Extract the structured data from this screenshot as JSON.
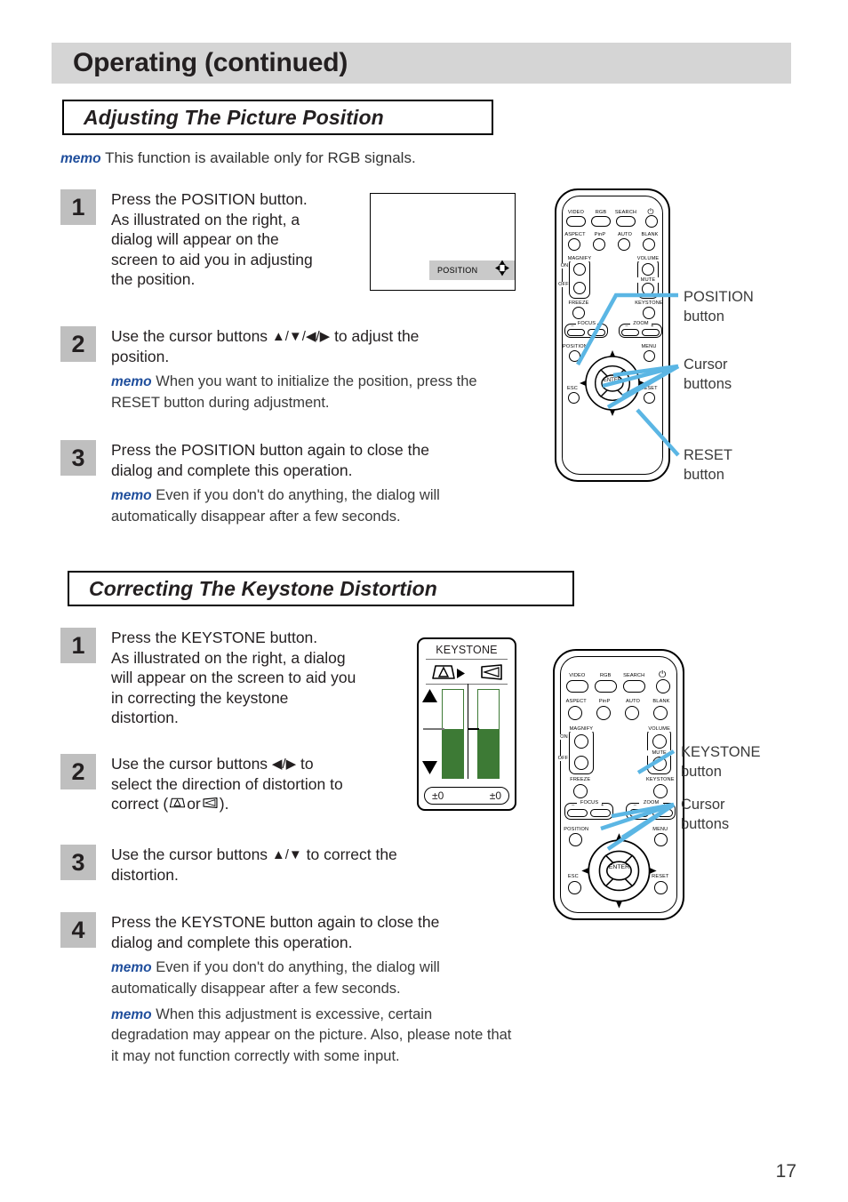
{
  "page": {
    "banner_title": "Operating (continued)",
    "page_number": "17"
  },
  "section1": {
    "title": "Adjusting The Picture Position",
    "intro_memo_word": "memo",
    "intro_memo_text": " This function is available only for RGB signals.",
    "steps": [
      {
        "number": "1",
        "line1": "Press the POSITION button.",
        "line2": "As illustrated on the right, a",
        "line3": "dialog will appear on the",
        "line4": "screen to aid you in adjusting",
        "line5": "the position."
      },
      {
        "number": "2",
        "text_before": "Use the cursor buttons ",
        "cursors": "▲/▼/◀/▶",
        "text_after": " to adjust the",
        "line2": "position.",
        "memo_word": "memo",
        "memo_text": "  When you want to initialize the position, press the RESET button during adjustment."
      },
      {
        "number": "3",
        "line1": "Press the POSITION button again to close the",
        "line2": "dialog and complete this operation.",
        "memo_word": "memo",
        "memo_text": "  Even if you don't do anything, the dialog will automatically disappear after a few seconds."
      }
    ],
    "osd": {
      "position_label": "POSITION"
    },
    "callouts": [
      {
        "line1": "POSITION",
        "line2": "button"
      },
      {
        "line1": "Cursor",
        "line2": "buttons"
      },
      {
        "line1": "RESET",
        "line2": "button"
      }
    ]
  },
  "section2": {
    "title": "Correcting The Keystone Distortion",
    "steps": [
      {
        "number": "1",
        "line1": "Press the KEYSTONE button.",
        "line2": "As illustrated on the right, a dialog",
        "line3": "will appear on the screen to aid you",
        "line4": "in correcting the keystone",
        "line5": "distortion."
      },
      {
        "number": "2",
        "text_before": "Use the cursor buttons  ",
        "cursors": "◀/▶",
        "text_after": "  to",
        "line2": "select the direction of distortion to",
        "line3_before": "correct (",
        "line3_or": "or",
        "line3_after": ")."
      },
      {
        "number": "3",
        "text_before": "Use the cursor buttons ",
        "cursors": "▲/▼",
        "text_after": " to correct the",
        "line2": "distortion."
      },
      {
        "number": "4",
        "line1": "Press the KEYSTONE button again to close the",
        "line2": "dialog and complete this operation.",
        "memo1_word": "memo",
        "memo1_text": "  Even if you don't do anything, the dialog will automatically disappear after a few seconds.",
        "memo2_word": "memo",
        "memo2_text": " When this adjustment is excessive, certain degradation may appear on the picture. Also, please note that it may not function correctly with some input."
      }
    ],
    "keystone_dialog": {
      "title": "KEYSTONE",
      "value_left": "±0",
      "value_right": "±0"
    },
    "callouts": [
      {
        "line1": "KEYSTONE",
        "line2": "button"
      },
      {
        "line1": "Cursor",
        "line2": "buttons"
      }
    ]
  },
  "remote": {
    "buttons_row1": [
      "VIDEO",
      "RGB",
      "SEARCH"
    ],
    "power_icon": "power-icon",
    "buttons_row2": [
      "ASPECT",
      "PinP",
      "AUTO",
      "BLANK"
    ],
    "magnify_label": "MAGNIFY",
    "magnify_on": "ON",
    "magnify_off": "OFF",
    "volume_label": "VOLUME",
    "mute_label": "MUTE",
    "freeze_label": "FREEZE",
    "keystone_label": "KEYSTONE",
    "focus_label": "FOCUS",
    "focus_minus": "–",
    "focus_plus": "+",
    "zoom_label": "ZOOM",
    "zoom_minus": "–",
    "zoom_plus": "+",
    "position_label": "POSITION",
    "menu_label": "MENU",
    "esc_label": "ESC",
    "reset_label": "RESET",
    "enter_label": "ENTER"
  },
  "colors": {
    "banner_grey": "#d5d5d5",
    "step_num_grey": "#bfbfbf",
    "memo_blue": "#1f4e9c",
    "keystone_green": "#3d7a35",
    "leader_blue": "#5bb6e4"
  }
}
